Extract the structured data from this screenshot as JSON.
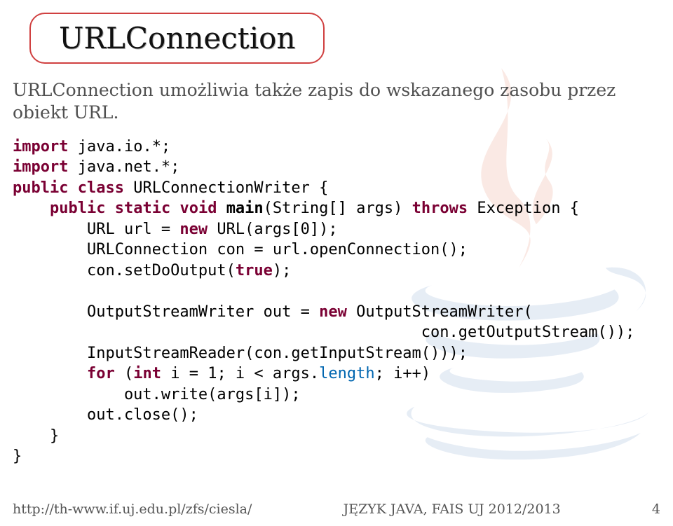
{
  "title": "URLConnection",
  "intro": "URLConnection umożliwia także zapis do wskazanego zasobu przez obiekt URL.",
  "code": {
    "l1a": "import",
    "l1b": " java.io.*;",
    "l2a": "import",
    "l2b": " java.net.*;",
    "l3a": "public",
    "l3b": " ",
    "l3c": "class",
    "l3d": " URLConnectionWriter {",
    "l4a": "    ",
    "l4b": "public",
    "l4c": " ",
    "l4d": "static",
    "l4e": " ",
    "l4f": "void",
    "l4g": " ",
    "l4h": "main",
    "l4i": "(String[] args) ",
    "l4j": "throws",
    "l4k": " Exception {",
    "l5a": "        URL url = ",
    "l5b": "new",
    "l5c": " URL(args[0]);",
    "l6": "        URLConnection con = url.openConnection();",
    "l7a": "        con.setDoOutput(",
    "l7b": "true",
    "l7c": ");",
    "blank1": "",
    "l8a": "        OutputStreamWriter out = ",
    "l8b": "new",
    "l8c": " OutputStreamWriter(",
    "l9": "                                            con.getOutputStream());",
    "l10": "        InputStreamReader(con.getInputStream()));",
    "l11a": "        ",
    "l11b": "for",
    "l11c": " (",
    "l11d": "int",
    "l11e": " i = 1; i < args.",
    "l11f": "length",
    "l11g": "; i++)",
    "l12": "            out.write(args[i]);",
    "l13": "        out.close();",
    "l14": "    }",
    "l15": "}"
  },
  "footer": {
    "left": "http://th-www.if.uj.edu.pl/zfs/ciesla/",
    "center": "JĘZYK JAVA, FAIS UJ 2012/2013",
    "right": "4"
  }
}
